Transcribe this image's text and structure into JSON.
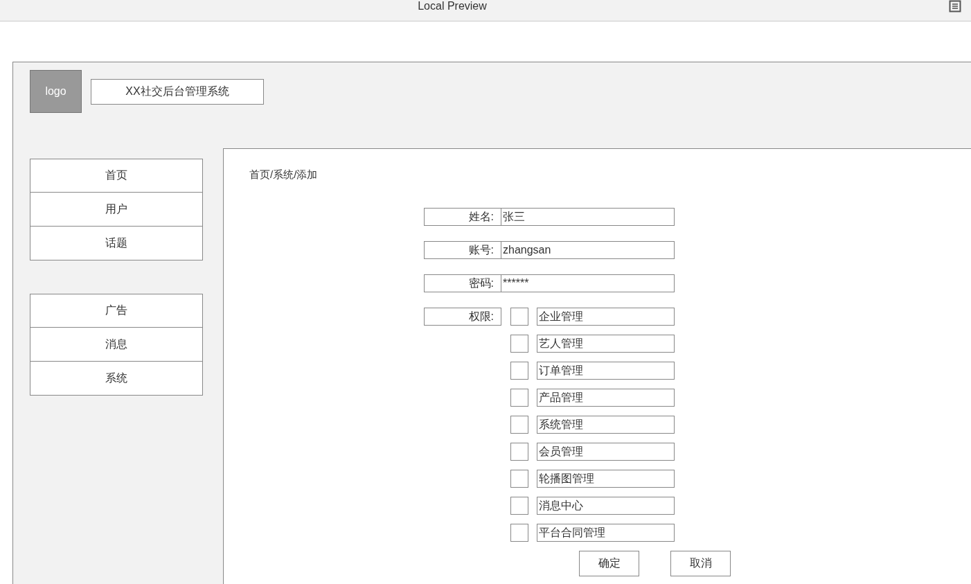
{
  "window": {
    "title": "Local Preview"
  },
  "header": {
    "logo": "logo",
    "title": "XX社交后台管理系统"
  },
  "sidebar": {
    "groups": [
      {
        "items": [
          {
            "label": "首页"
          },
          {
            "label": "用户"
          },
          {
            "label": "话题"
          }
        ]
      },
      {
        "items": [
          {
            "label": "广告"
          },
          {
            "label": "消息"
          },
          {
            "label": "系统"
          }
        ]
      }
    ]
  },
  "breadcrumb": "首页/系统/添加",
  "form": {
    "fields": [
      {
        "label": "姓名:",
        "value": "张三"
      },
      {
        "label": "账号:",
        "value": "zhangsan"
      },
      {
        "label": "密码:",
        "value": "******"
      }
    ],
    "permissions": {
      "label": "权限:",
      "options": [
        {
          "label": "企业管理",
          "checked": false
        },
        {
          "label": "艺人管理",
          "checked": false
        },
        {
          "label": "订单管理",
          "checked": false
        },
        {
          "label": "产品管理",
          "checked": false
        },
        {
          "label": "系统管理",
          "checked": false
        },
        {
          "label": "会员管理",
          "checked": false
        },
        {
          "label": "轮播图管理",
          "checked": false
        },
        {
          "label": "消息中心",
          "checked": false
        },
        {
          "label": "平台合同管理",
          "checked": false
        }
      ]
    },
    "buttons": [
      "确定",
      "取消"
    ]
  }
}
